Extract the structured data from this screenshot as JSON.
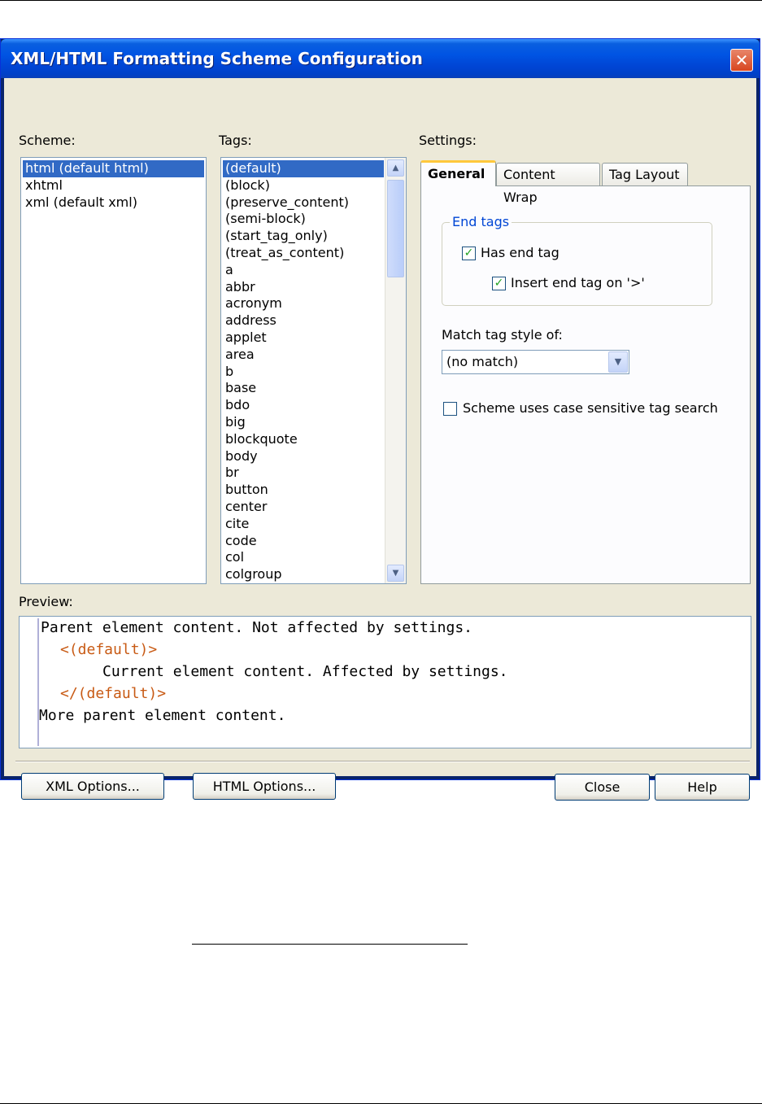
{
  "window": {
    "title": "XML/HTML Formatting Scheme Configuration",
    "close_glyph": "✕"
  },
  "scheme": {
    "label": "Scheme:",
    "items": [
      "html (default html)",
      "xhtml",
      "xml (default xml)"
    ],
    "selected": "html (default html)"
  },
  "tags": {
    "label": "Tags:",
    "items": [
      "(default)",
      "(block)",
      "(preserve_content)",
      "(semi-block)",
      "(start_tag_only)",
      "(treat_as_content)",
      "a",
      "abbr",
      "acronym",
      "address",
      "applet",
      "area",
      "b",
      "base",
      "bdo",
      "big",
      "blockquote",
      "body",
      "br",
      "button",
      "center",
      "cite",
      "code",
      "col",
      "colgroup"
    ],
    "selected": "(default)"
  },
  "settings": {
    "label": "Settings:",
    "tabs": [
      "General",
      "Content Wrap",
      "Tag Layout"
    ],
    "active_tab": "General",
    "end_tags": {
      "title": "End tags",
      "has_end_tag_label": "Has end tag",
      "has_end_tag_checked": true,
      "insert_end_tag_label": "Insert end tag on '>'",
      "insert_end_tag_checked": true
    },
    "match_label": "Match tag style of:",
    "match_value": "(no match)",
    "case_sensitive_label": "Scheme uses case sensitive tag search",
    "case_sensitive_checked": false
  },
  "preview": {
    "label": "Preview:",
    "line1": "Parent element content. Not affected by settings.",
    "line2": "<(default)>",
    "line3": "Current element content. Affected by settings.",
    "line4": "</(default)>",
    "line5": "More parent element content."
  },
  "buttons": {
    "xml_options": "XML Options...",
    "html_options": "HTML Options...",
    "close": "Close",
    "help": "Help"
  },
  "colors": {
    "title_bar": "#0054e3",
    "selection": "#316ac5",
    "preview_tag": "#c85a14"
  }
}
